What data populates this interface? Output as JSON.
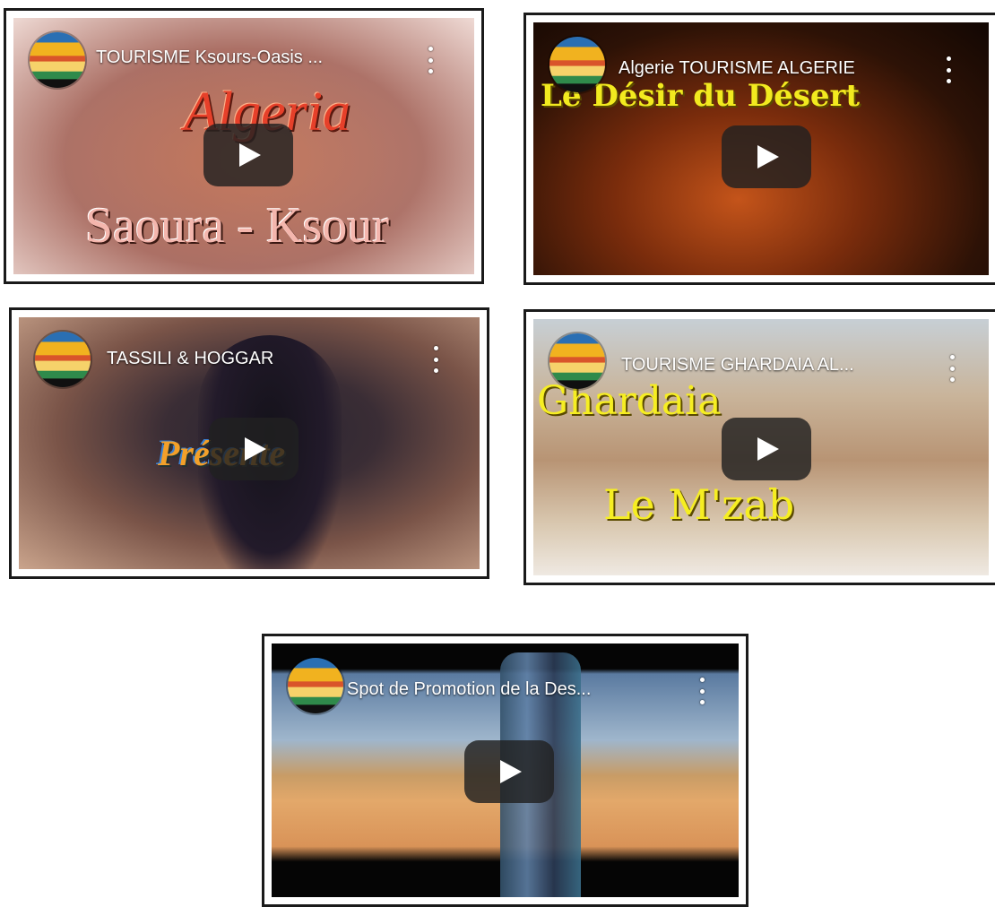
{
  "videos": [
    {
      "title": "TOURISME Ksours-Oasis ...",
      "overlay_top": "Algeria",
      "overlay_bottom": "Saoura - Ksour"
    },
    {
      "title": "Algerie TOURISME ALGERIE",
      "overlay_top": "Le Désir du Désert",
      "overlay_bottom": ""
    },
    {
      "title": "TASSILI & HOGGAR",
      "overlay_top": "Présente",
      "overlay_bottom": ""
    },
    {
      "title": "TOURISME GHARDAIA AL...",
      "overlay_top": "Ghardaia",
      "overlay_bottom": "Le M'zab"
    },
    {
      "title": "Spot de Promotion de la Des...",
      "overlay_top": "",
      "overlay_bottom": ""
    }
  ],
  "icons": {
    "channel_logo": "channel-logo",
    "more": "more-vert-icon",
    "play": "play-icon"
  }
}
